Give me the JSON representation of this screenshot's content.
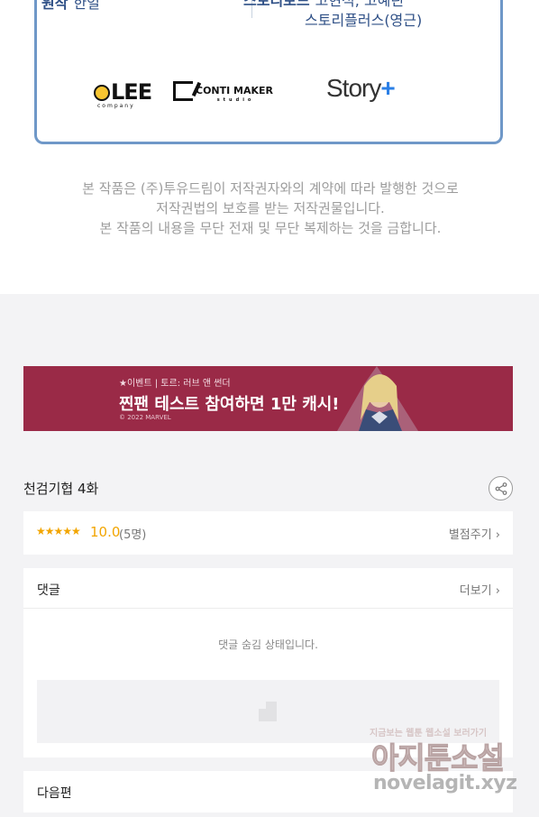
{
  "credits": {
    "left_role": "원작",
    "left_name": "한얼",
    "right_role": "스토리보드",
    "right_names_1": "고현석, 고혜린",
    "right_names_2": "스토리플러스(영근)"
  },
  "logos": {
    "lee": "LEE",
    "lee_sub": "company",
    "conti": "CONTI MAKER",
    "conti_sub": "studio",
    "story": "Story",
    "story_plus": "+"
  },
  "notice": {
    "line1": "본 작품은 (주)투유드림이 저작권자와의 계약에 따라 발행한 것으로",
    "line2": "저작권법의 보호를 받는 저작권물입니다.",
    "line3": "본 작품의 내용을 무단 전재 및 무단 복제하는 것을 금합니다."
  },
  "banner": {
    "sub": "★이벤트 | 토르: 러브 앤 썬더",
    "title": "찐팬 테스트 참여하면 1만 캐시!",
    "copyright": "© 2022 MARVEL",
    "bg_color": "#9a2a47"
  },
  "episode": {
    "title": "천검기협 4화",
    "share_icon": "share-icon"
  },
  "rating": {
    "stars": "★★★★★",
    "score": "10.0",
    "count": "(5명)",
    "rate_link": "별점주기",
    "accent": "#f2a500"
  },
  "comments": {
    "title": "댓글",
    "more": "더보기",
    "hidden_message": "댓글 숨김 상태입니다."
  },
  "next": {
    "title": "다음편"
  },
  "watermark": {
    "small": "지금보는 웹툰 웹소설 보러가기",
    "big": "아지툰소설",
    "url": "novelagit.xyz"
  }
}
